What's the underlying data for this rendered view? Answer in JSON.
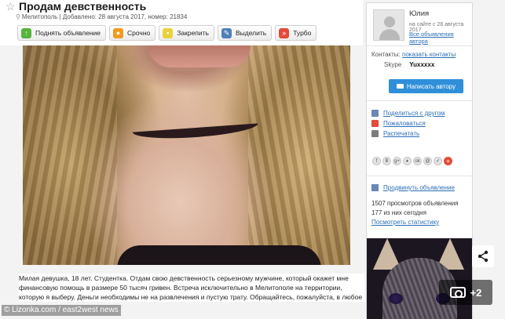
{
  "listing": {
    "title": "Продам девственность",
    "meta": "Мелитополь | Добавлено: 28 августа 2017, номер: 21834",
    "buttons": [
      {
        "label": "Поднять объявление",
        "icon": "arrow-up-icon"
      },
      {
        "label": "Срочно",
        "icon": "fire-icon"
      },
      {
        "label": "Закрепить",
        "icon": "pin-icon"
      },
      {
        "label": "Выделить",
        "icon": "highlight-icon"
      },
      {
        "label": "Турбо",
        "icon": "turbo-icon"
      }
    ],
    "description": "Милая девушка, 18 лет. Студентка. Отдам свою девственность серьезному мужчине, который окажет мне финансовую помощь в размере 50 тысяч гривен. Встреча исключительно в Мелитополе на территории, которую я выберу. Деньги необходимы не на развлечения и пустую трату. Обращайтесь, пожалуйста, в любое"
  },
  "seller": {
    "name": "Юлия",
    "since": "на сайте с 28 августа 2017",
    "all_ads_link": "Все объявления автора",
    "contacts_label": "Контакты:",
    "contacts_link": "показать контакты",
    "skype_label": "Skype",
    "skype_value": "Yuxxxxx",
    "write_button": "Написать автору"
  },
  "actions": {
    "share": "Поделиться с другом",
    "report": "Пожаловаться",
    "print": "Распечатать",
    "promote": "Продвинуть объявление"
  },
  "socials": [
    "f",
    "B",
    "g+",
    "♦",
    "ok",
    "@",
    "✓"
  ],
  "stats": {
    "views": "1507 просмотров объявления",
    "today": "177 из них сегодня",
    "link": "Посмотреть статистику"
  },
  "overlay": {
    "credit": "© Lizonka.com / east2west news",
    "photo_count": "+2"
  },
  "colors": {
    "link": "#2b6fb6",
    "write_button": "#2f8fd8"
  }
}
